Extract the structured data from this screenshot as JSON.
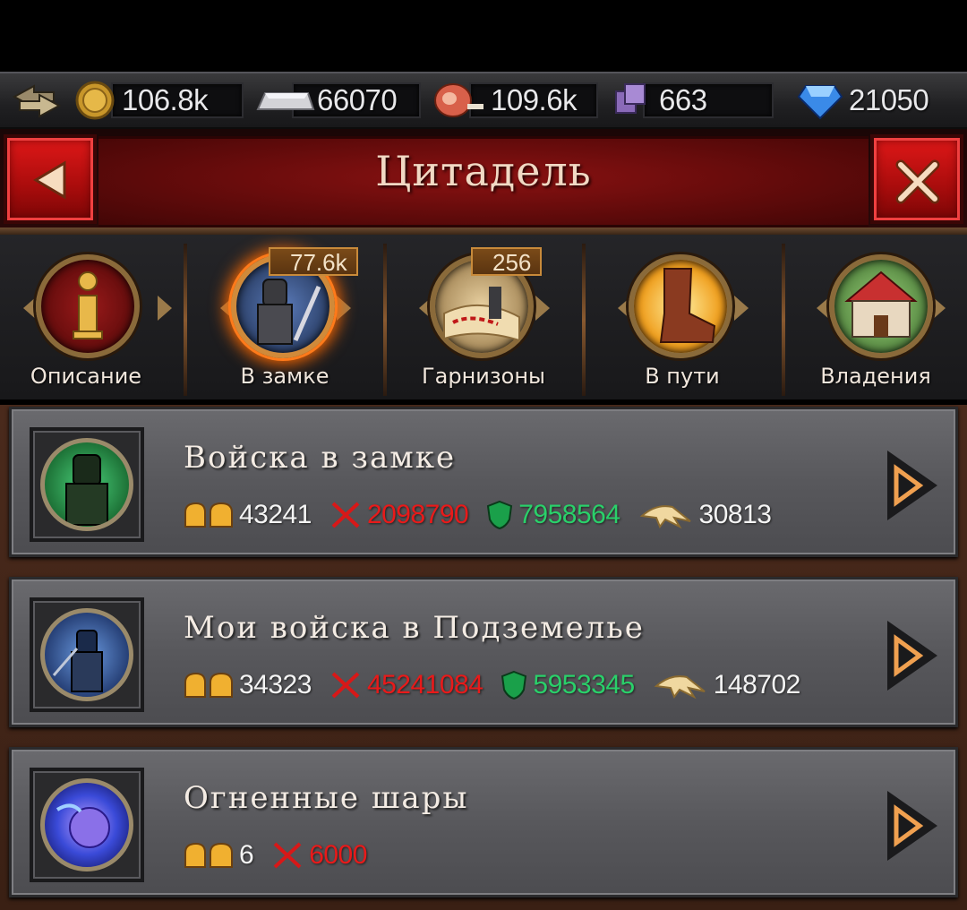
{
  "resources": [
    {
      "icon": "gold-coin-icon",
      "value": "106.8k"
    },
    {
      "icon": "silver-bar-icon",
      "value": "66070"
    },
    {
      "icon": "meat-icon",
      "value": "109.6k"
    },
    {
      "icon": "stone-block-icon",
      "value": "663"
    },
    {
      "icon": "diamond-icon",
      "value": "21050"
    }
  ],
  "header": {
    "title": "Цитадель"
  },
  "tabs": [
    {
      "label": "Описание",
      "icon": "info-icon",
      "badge": ""
    },
    {
      "label": "В замке",
      "icon": "knight-icon",
      "badge": "77.6k",
      "active": true
    },
    {
      "label": "Гарнизоны",
      "icon": "map-icon",
      "badge": "256"
    },
    {
      "label": "В пути",
      "icon": "boot-icon",
      "badge": ""
    },
    {
      "label": "Владения",
      "icon": "house-icon",
      "badge": ""
    }
  ],
  "cards": [
    {
      "title": "Войска в замке",
      "troops": "43241",
      "attack": "2098790",
      "defense": "7958564",
      "speed": "30813",
      "icon": "green-knight-icon"
    },
    {
      "title": "Мои войска в Подземелье",
      "troops": "34323",
      "attack": "45241084",
      "defense": "5953345",
      "speed": "148702",
      "icon": "blue-knight-icon"
    },
    {
      "title": "Огненные шары",
      "troops": "6",
      "attack": "6000",
      "icon": "fireball-icon"
    }
  ],
  "colors": {
    "accent": "#8a1212",
    "attack": "#e81a1a",
    "defense": "#2ad06a",
    "gold": "#f0b030"
  }
}
